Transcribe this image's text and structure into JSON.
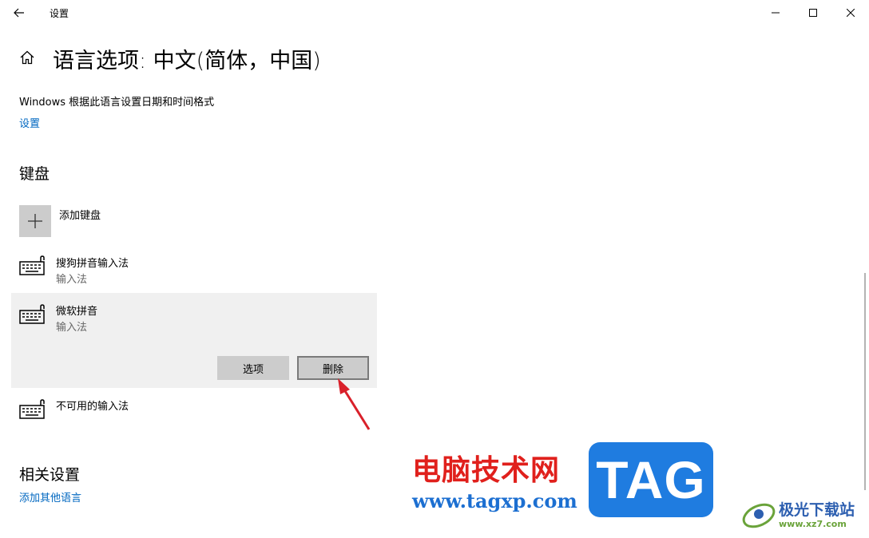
{
  "window": {
    "title": "设置",
    "controls": [
      "minimize-icon",
      "maximize-icon",
      "close-icon"
    ]
  },
  "page": {
    "title": "语言选项: 中文(简体，中国)",
    "description": "Windows 根据此语言设置日期和时间格式",
    "settings_link": "设置"
  },
  "keyboard": {
    "section_title": "键盘",
    "add_label": "添加键盘",
    "items": [
      {
        "name": "搜狗拼音输入法",
        "type": "输入法"
      },
      {
        "name": "微软拼音",
        "type": "输入法",
        "selected": true,
        "options_label": "选项",
        "delete_label": "删除"
      },
      {
        "name": "不可用的输入法"
      }
    ]
  },
  "related": {
    "section_title": "相关设置",
    "add_language_link": "添加其他语言"
  },
  "watermark": {
    "site_name": "电脑技术网",
    "site_url": "www.tagxp.com",
    "tag_badge": "TAG",
    "logo_name": "极光下载站",
    "logo_url": "www.xz7.com"
  },
  "colors": {
    "link": "#0067c0",
    "selected_bg": "#f0f0f0",
    "button_bg": "#cccccc",
    "arrow": "#d9202a",
    "tag_bg": "#1f7ce0"
  }
}
